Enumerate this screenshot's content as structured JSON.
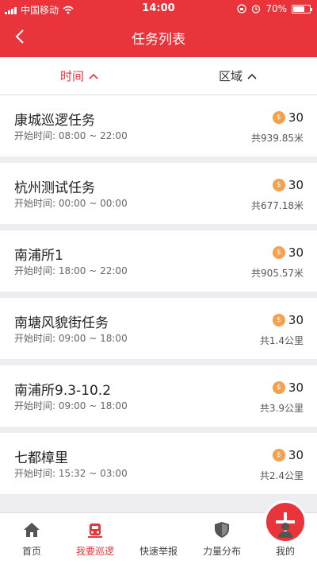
{
  "status_bar": {
    "carrier": "中国移动",
    "time": "14:00",
    "battery": "70%",
    "battery_level": 0.7
  },
  "header": {
    "title": "任务列表"
  },
  "sort": {
    "time_label": "时间",
    "area_label": "区域"
  },
  "tasks": [
    {
      "name": "康城巡逻任务",
      "time": "开始时间:  08:00 ~ 22:00",
      "points": "30",
      "distance": "共939.85米"
    },
    {
      "name": "杭州测试任务",
      "time": "开始时间:  00:00 ~ 00:00",
      "points": "30",
      "distance": "共677.18米"
    },
    {
      "name": "南浦所1",
      "time": "开始时间:  18:00 ~ 22:00",
      "points": "30",
      "distance": "共905.57米"
    },
    {
      "name": "南塘风貌街任务",
      "time": "开始时间:  09:00 ~ 18:00",
      "points": "30",
      "distance": "共1.4公里"
    },
    {
      "name": "南浦所9.3-10.2",
      "time": "开始时间:  09:00 ~ 18:00",
      "points": "30",
      "distance": "共3.9公里"
    },
    {
      "name": "七都樟里",
      "time": "开始时间:  15:32 ~ 03:00",
      "points": "30",
      "distance": "共2.4公里"
    }
  ],
  "tabbar": {
    "home": "首页",
    "patrol": "我要巡逻",
    "report": "快速举报",
    "force": "力量分布",
    "mine": "我的"
  },
  "colors": {
    "brand": "#e8343a",
    "coin": "#f5a04c"
  },
  "icons": [
    "back-icon",
    "chevron-up-icon",
    "coin-icon",
    "home-icon",
    "siren-icon",
    "plus-icon",
    "shield-icon",
    "user-icon"
  ]
}
